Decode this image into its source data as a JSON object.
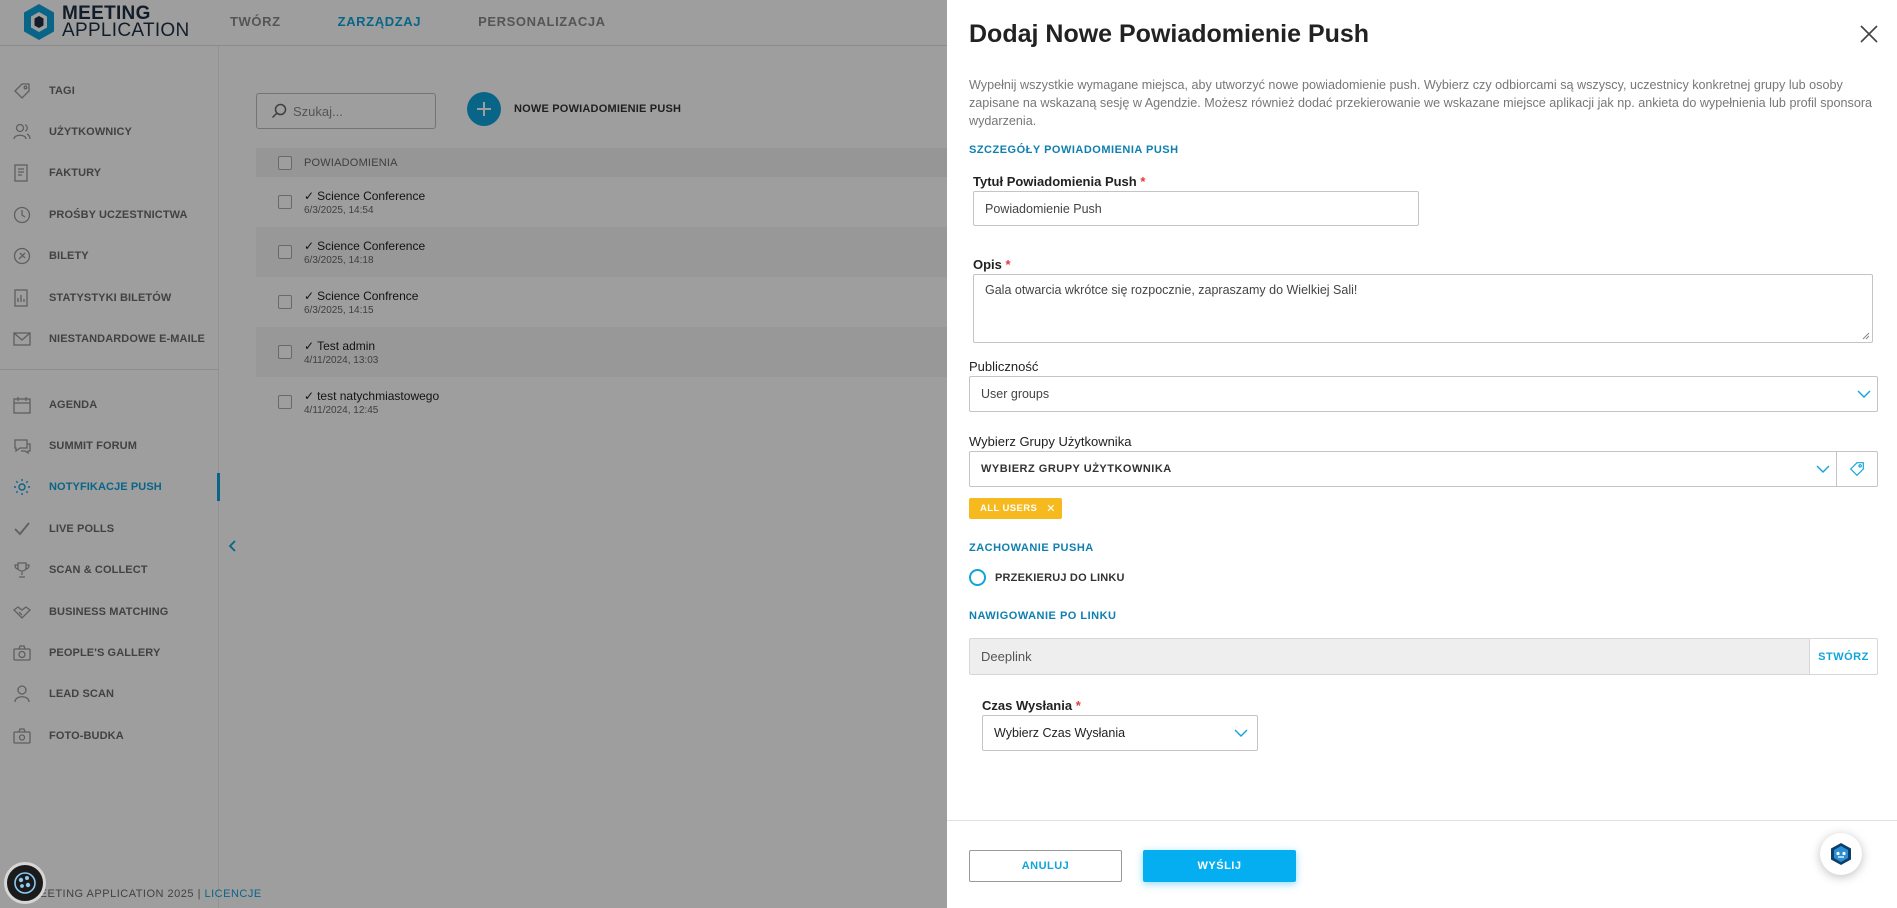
{
  "app": {
    "logo_line1": "MEETING",
    "logo_line2": "APPLICATION",
    "brand_color": "#10a4dc"
  },
  "topnav": [
    {
      "label": "TWÓRZ",
      "active": false
    },
    {
      "label": "ZARZĄDZAJ",
      "active": true
    },
    {
      "label": "PERSONALIZACJA",
      "active": false
    }
  ],
  "sidebar": {
    "items": [
      {
        "label": "TAGI",
        "icon": "tag-icon"
      },
      {
        "label": "UŻYTKOWNICY",
        "icon": "users-icon"
      },
      {
        "label": "FAKTURY",
        "icon": "invoice-icon"
      },
      {
        "label": "PROŚBY UCZESTNICTWA",
        "icon": "clock-icon"
      },
      {
        "label": "BILETY",
        "icon": "ticket-icon"
      },
      {
        "label": "STATYSTYKI BILETÓW",
        "icon": "stats-icon"
      },
      {
        "label": "NIESTANDARDOWE E-MAILE",
        "icon": "mail-icon"
      },
      {
        "label": "AGENDA",
        "icon": "calendar-icon"
      },
      {
        "label": "SUMMIT FORUM",
        "icon": "chat-icon"
      },
      {
        "label": "NOTYFIKACJE PUSH",
        "icon": "push-icon",
        "active": true
      },
      {
        "label": "LIVE POLLS",
        "icon": "check-icon"
      },
      {
        "label": "SCAN & COLLECT",
        "icon": "trophy-icon"
      },
      {
        "label": "BUSINESS MATCHING",
        "icon": "handshake-icon"
      },
      {
        "label": "PEOPLE'S GALLERY",
        "icon": "camera-icon"
      },
      {
        "label": "LEAD SCAN",
        "icon": "user-icon"
      },
      {
        "label": "FOTO-BUDKA",
        "icon": "photo-booth-icon"
      }
    ]
  },
  "footer": {
    "text": "MEETING APPLICATION 2025 | ",
    "link": "LICENCJE"
  },
  "main": {
    "search_placeholder": "Szukaj...",
    "new_push_label": "NOWE POWIADOMIENIE PUSH",
    "list_header": "POWIADOMIENIA",
    "rows": [
      {
        "title": "Science Conference",
        "date": "6/3/2025, 14:54"
      },
      {
        "title": "Science Conference",
        "date": "6/3/2025, 14:18"
      },
      {
        "title": "Science Confrence",
        "date": "6/3/2025, 14:15"
      },
      {
        "title": "Test admin",
        "date": "4/11/2024, 13:03"
      },
      {
        "title": "test natychmiastowego",
        "date": "4/11/2024, 12:45"
      }
    ]
  },
  "panel": {
    "title": "Dodaj Nowe Powiadomienie Push",
    "description": "Wypełnij wszystkie wymagane miejsca, aby utworzyć nowe powiadomienie push. Wybierz czy odbiorcami są wszyscy, uczestnicy konkretnej grupy lub osoby zapisane na wskazaną sesję w Agendzie. Możesz również dodać przekierowanie we wskazane miejsce aplikacji jak np. ankieta do wypełnienia lub profil sponsora wydarzenia.",
    "section_details": "SZCZEGÓŁY POWIADOMIENIA PUSH",
    "title_label": "Tytuł Powiadomienia Push",
    "title_value": "Powiadomienie Push",
    "desc_label": "Opis",
    "desc_value": "Gala otwarcia wkrótce się rozpocznie, zapraszamy do Wielkiej Sali!",
    "audience_label": "Publiczność",
    "audience_value": "User groups",
    "groups_label": "Wybierz Grupy Użytkownika",
    "groups_placeholder": "WYBIERZ GRUPY UŻYTKOWNIKA",
    "selected_tag": "ALL USERS",
    "section_behavior": "ZACHOWANIE PUSHA",
    "redirect_label": "PRZEKIERUJ DO LINKU",
    "section_nav": "NAWIGOWANIE PO LINKU",
    "deeplink_placeholder": "Deeplink",
    "create_label": "STWÓRZ",
    "send_time_label": "Czas Wysłania",
    "send_time_value": "Wybierz Czas Wysłania",
    "required_mark": "*",
    "cancel_label": "ANULUJ",
    "send_label": "WYŚLIJ"
  }
}
